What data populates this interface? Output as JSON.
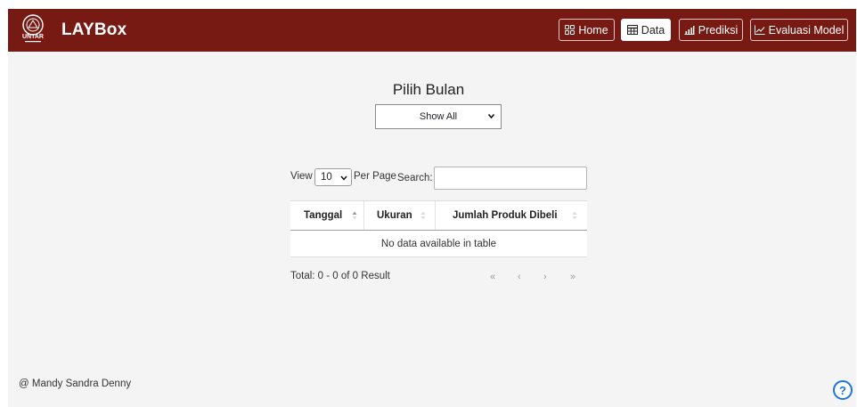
{
  "navbar": {
    "logo_text": "UNTAR",
    "brand": "LAYBox",
    "buttons": [
      {
        "label": "Home",
        "icon": "grid-icon",
        "active": false
      },
      {
        "label": "Data",
        "icon": "table-icon",
        "active": true
      },
      {
        "label": "Prediksi",
        "icon": "bar-chart-icon",
        "active": false
      },
      {
        "label": "Evaluasi Model",
        "icon": "line-chart-icon",
        "active": false
      }
    ],
    "colors": {
      "bar": "#781a14",
      "active_bg": "#ffffff"
    }
  },
  "filter": {
    "title": "Pilih Bulan",
    "selected": "Show All"
  },
  "table_controls": {
    "view_label": "View",
    "per_page_value": "10",
    "per_page_label": "Per Page",
    "search_label": "Search:",
    "search_value": ""
  },
  "table": {
    "columns": [
      "Tanggal",
      "Ukuran",
      "Jumlah Produk Dibeli"
    ],
    "empty_message": "No data available in table"
  },
  "summary": {
    "total_text": "Total: 0 - 0 of 0 Result"
  },
  "pagination": {
    "first": "«",
    "prev": "‹",
    "next": "›",
    "last": "»"
  },
  "footer": {
    "credit": "@ Mandy Sandra Denny"
  },
  "help": {
    "label": "?"
  }
}
